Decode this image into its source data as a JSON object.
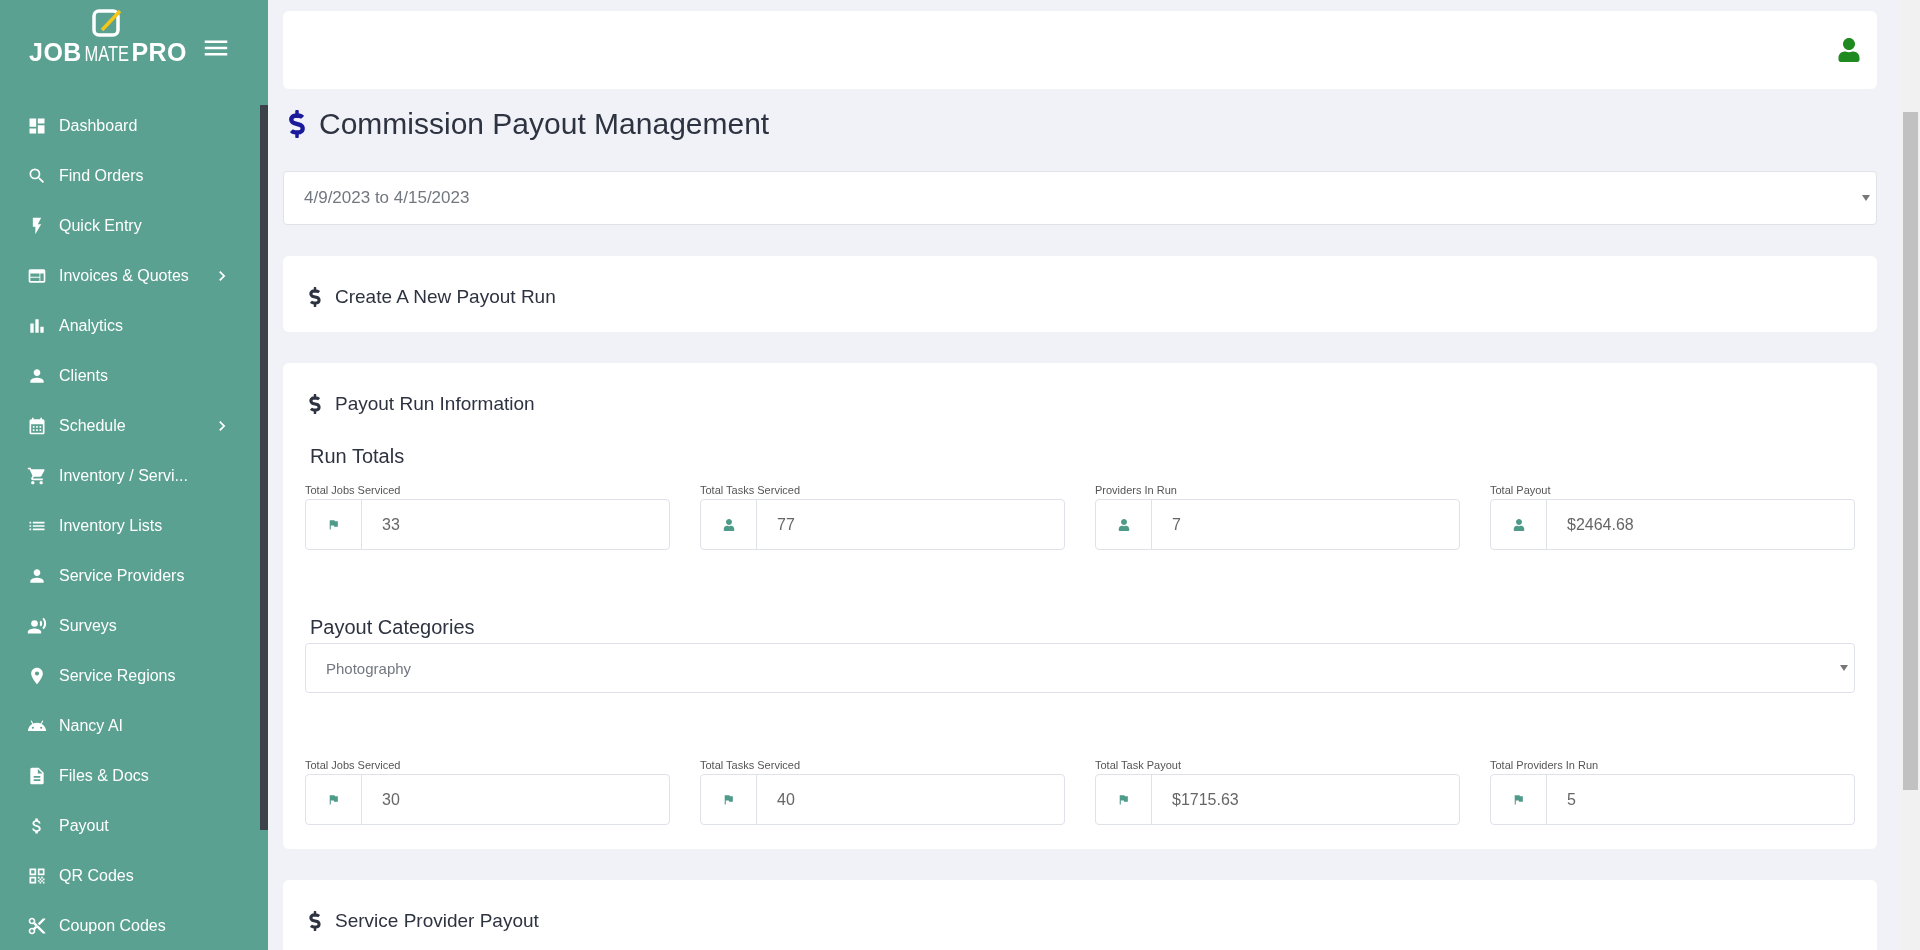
{
  "sidebar": {
    "logo": {
      "parts": [
        "JOB",
        "MATE",
        "PRO"
      ]
    },
    "items": [
      {
        "label": "Dashboard",
        "submenu": false
      },
      {
        "label": "Find Orders",
        "submenu": false
      },
      {
        "label": "Quick Entry",
        "submenu": false
      },
      {
        "label": "Invoices & Quotes",
        "submenu": true
      },
      {
        "label": "Analytics",
        "submenu": false
      },
      {
        "label": "Clients",
        "submenu": false
      },
      {
        "label": "Schedule",
        "submenu": true
      },
      {
        "label": "Inventory / Servi...",
        "submenu": false
      },
      {
        "label": "Inventory Lists",
        "submenu": false
      },
      {
        "label": "Service Providers",
        "submenu": false
      },
      {
        "label": "Surveys",
        "submenu": false
      },
      {
        "label": "Service Regions",
        "submenu": false
      },
      {
        "label": "Nancy AI",
        "submenu": false
      },
      {
        "label": "Files & Docs",
        "submenu": false
      },
      {
        "label": "Payout",
        "submenu": false
      },
      {
        "label": "QR Codes",
        "submenu": false
      },
      {
        "label": "Coupon Codes",
        "submenu": false
      }
    ]
  },
  "page": {
    "title": "Commission Payout Management",
    "date_range": "4/9/2023 to 4/15/2023"
  },
  "cards": [
    {
      "title": "Create A New Payout Run"
    },
    {
      "title": "Payout Run Information",
      "run_totals": {
        "heading": "Run Totals",
        "fields": [
          {
            "label": "Total Jobs Serviced",
            "value": "33",
            "kind": "flag"
          },
          {
            "label": "Total Tasks Serviced",
            "value": "77",
            "kind": "person"
          },
          {
            "label": "Providers In Run",
            "value": "7",
            "kind": "person"
          },
          {
            "label": "Total Payout",
            "value": "$2464.68",
            "kind": "person"
          }
        ]
      },
      "categories": {
        "heading": "Payout Categories",
        "selected": "Photography",
        "fields": [
          {
            "label": "Total Jobs Serviced",
            "value": "30",
            "kind": "flag"
          },
          {
            "label": "Total Tasks Serviced",
            "value": "40",
            "kind": "flag"
          },
          {
            "label": "Total Task Payout",
            "value": "$1715.63",
            "kind": "flag"
          },
          {
            "label": "Total Providers In Run",
            "value": "5",
            "kind": "flag"
          }
        ]
      }
    },
    {
      "title": "Service Provider Payout"
    }
  ]
}
